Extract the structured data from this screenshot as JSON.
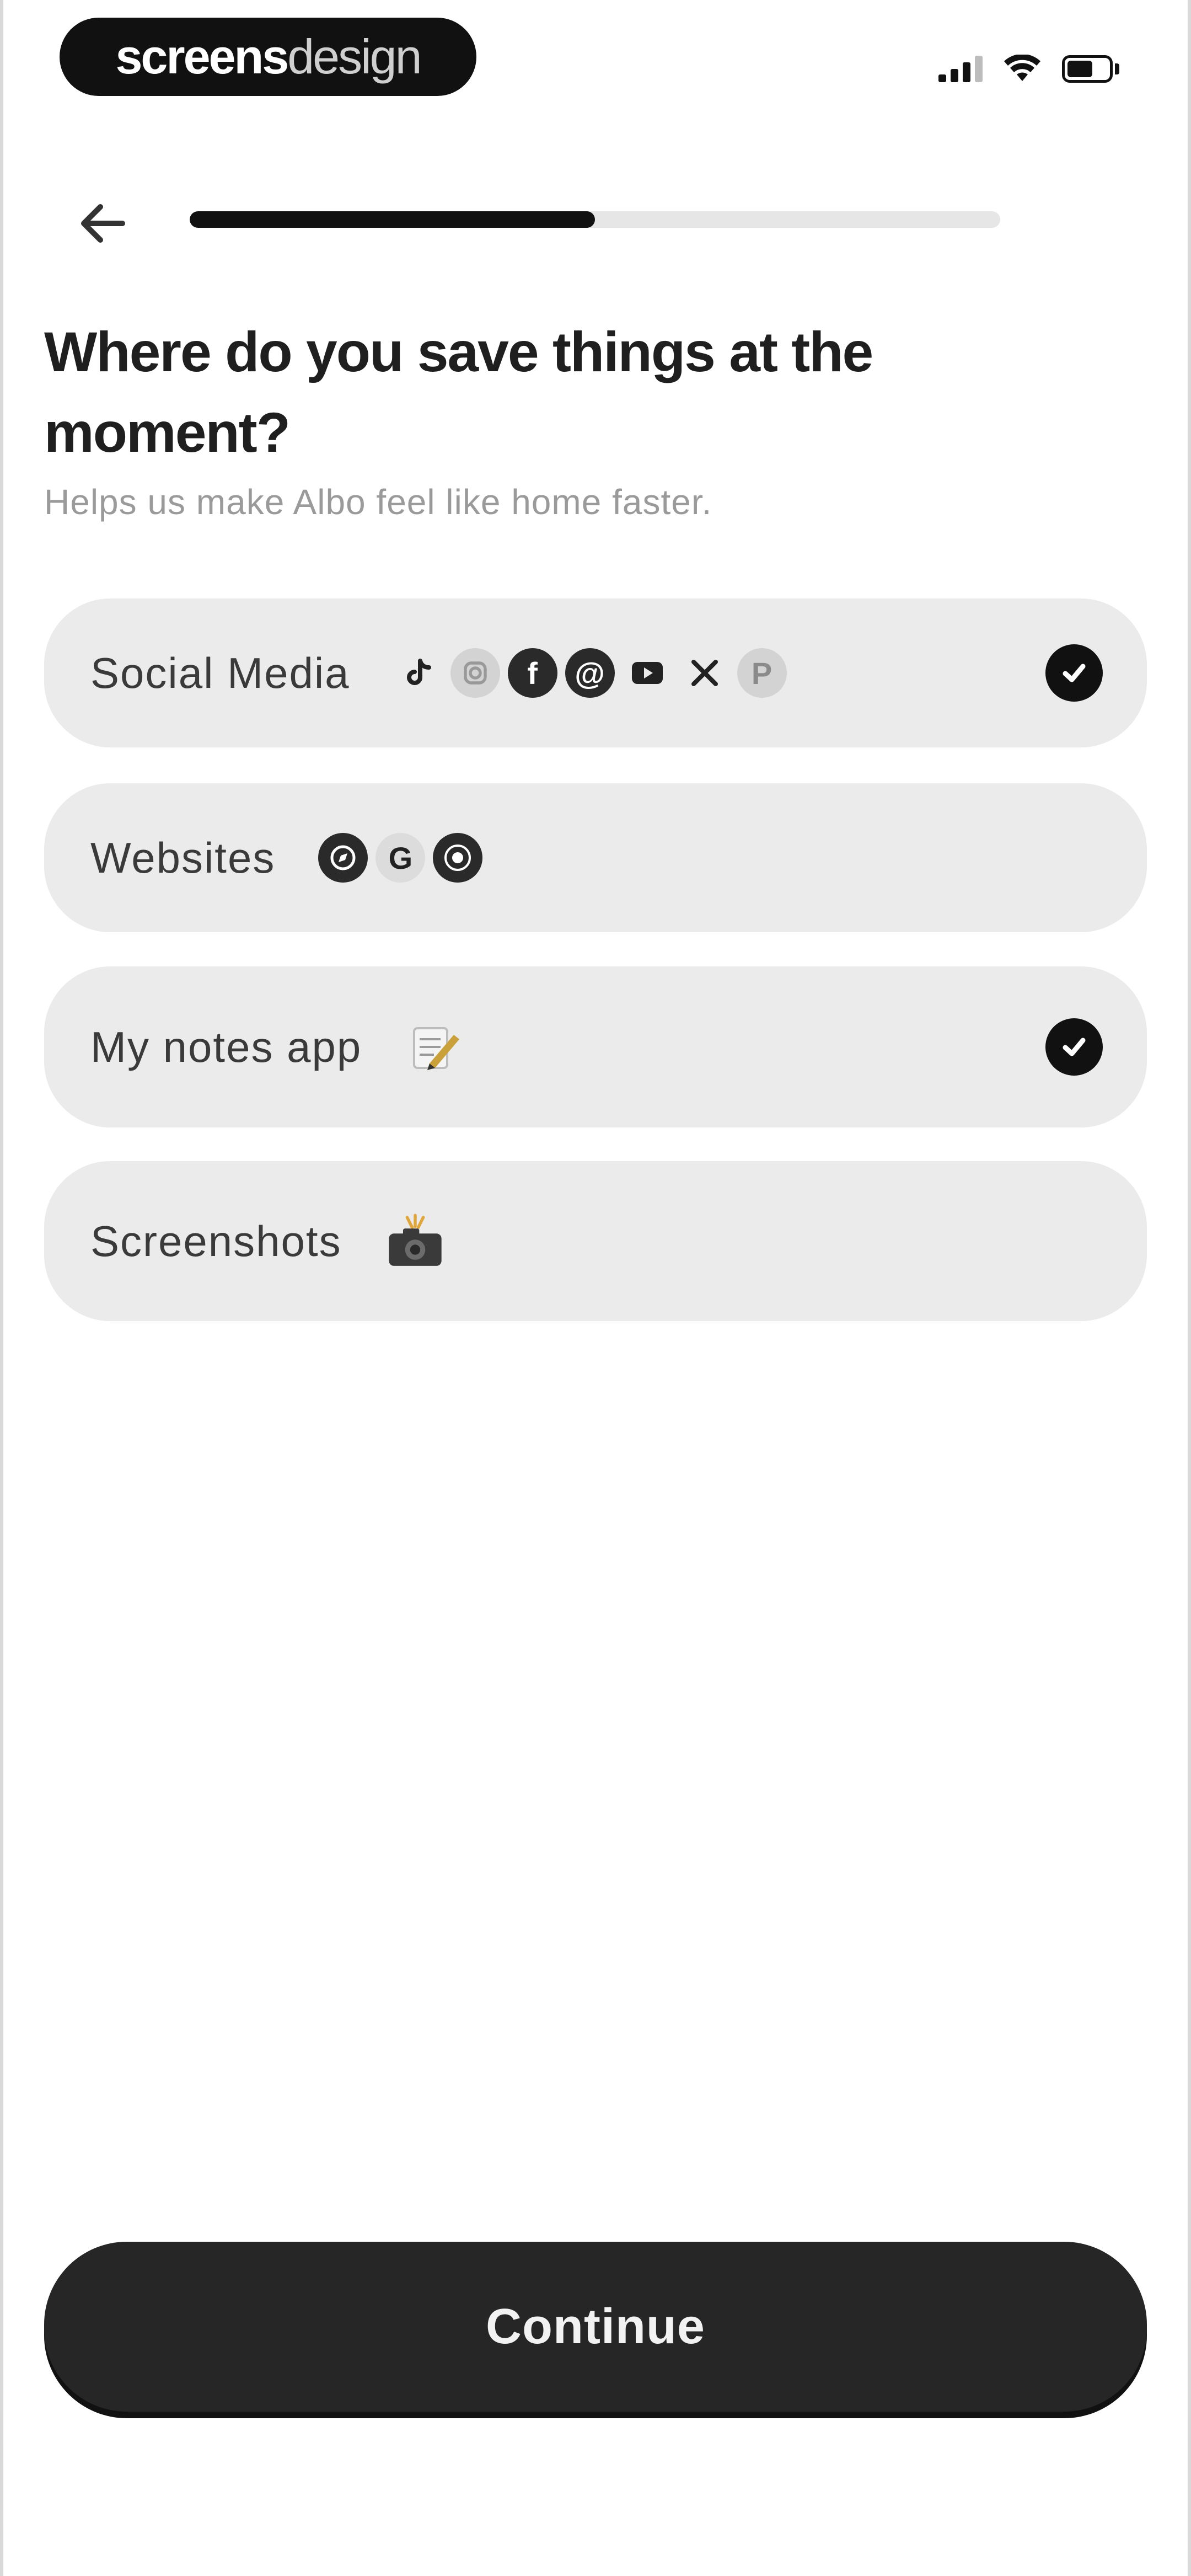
{
  "status_bar": {
    "brand_part1": "screens",
    "brand_part2": "design"
  },
  "header": {
    "back_icon": "arrow-left-icon",
    "progress_value": 0.5
  },
  "question": {
    "title": "Where do you save things at the moment?",
    "subtitle": "Helps us make Albo feel like home faster."
  },
  "options": [
    {
      "label": "Social Media",
      "selected": true,
      "icons": [
        "tiktok-icon",
        "instagram-icon",
        "facebook-icon",
        "threads-icon",
        "youtube-icon",
        "x-icon",
        "pinterest-icon"
      ]
    },
    {
      "label": "Websites",
      "selected": false,
      "icons": [
        "safari-icon",
        "google-icon",
        "chrome-icon"
      ]
    },
    {
      "label": "My notes app",
      "selected": true,
      "icons": [
        "memo-pencil-icon"
      ]
    },
    {
      "label": "Screenshots",
      "selected": false,
      "icons": [
        "camera-flash-icon"
      ]
    }
  ],
  "footer": {
    "continue_label": "Continue"
  }
}
